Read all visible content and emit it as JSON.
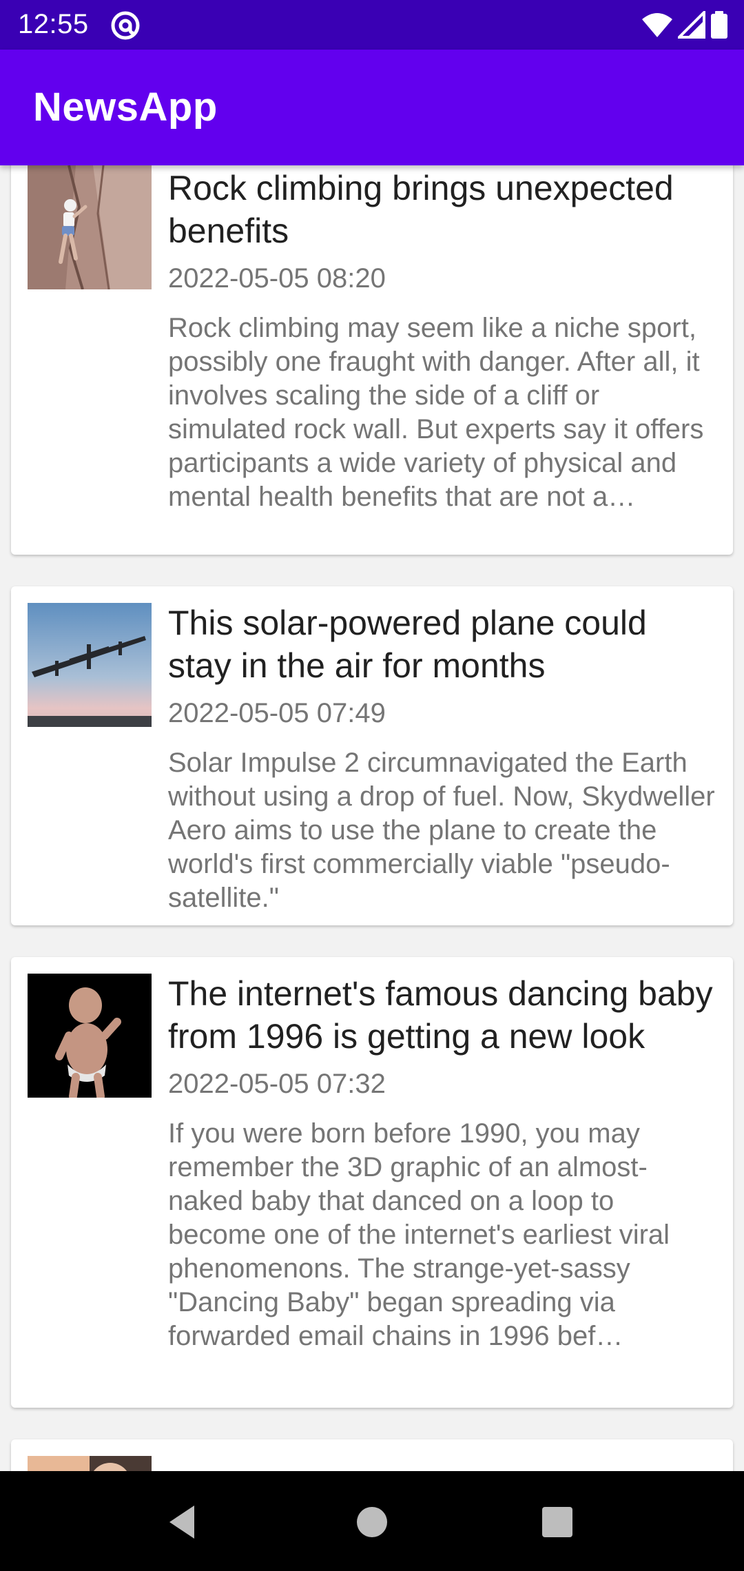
{
  "status_bar": {
    "time": "12:55",
    "app_icon": "at-sign-icon",
    "icons": [
      "wifi-icon",
      "signal-icon",
      "battery-icon"
    ]
  },
  "app_bar": {
    "title": "NewsApp",
    "color": "#6200ee"
  },
  "articles": [
    {
      "headline": "Rock climbing brings unexpected benefits",
      "timestamp": "2022-05-05 08:20",
      "summary": "Rock climbing may seem like a niche sport, possibly one fraught with danger. After all, it involves scaling the side of a cliff or simulated rock wall. But experts say it offers participants a wide variety of physical and mental health benefits that are not a…",
      "thumbnail": "rock-climber-photo"
    },
    {
      "headline": "This solar-powered plane could stay in the air for months",
      "timestamp": "2022-05-05 07:49",
      "summary": "Solar Impulse 2 circumnavigated the Earth without using a drop of fuel. Now, Skydweller Aero aims to use the plane to create the world's first commercially viable \"pseudo-satellite.\"",
      "thumbnail": "solar-plane-photo"
    },
    {
      "headline": "The internet's famous dancing baby from 1996 is getting a new look",
      "timestamp": "2022-05-05 07:32",
      "summary": "If you were born before 1990, you may remember the 3D graphic of an almost-naked baby that danced on a loop to become one of the internet's earliest viral phenomenons. The strange-yet-sassy \"Dancing Baby\" began spreading via forwarded email chains in 1996 bef…",
      "thumbnail": "dancing-baby-render"
    }
  ],
  "nav_bar": {
    "icons": [
      "back-icon",
      "home-icon",
      "recents-icon"
    ]
  }
}
